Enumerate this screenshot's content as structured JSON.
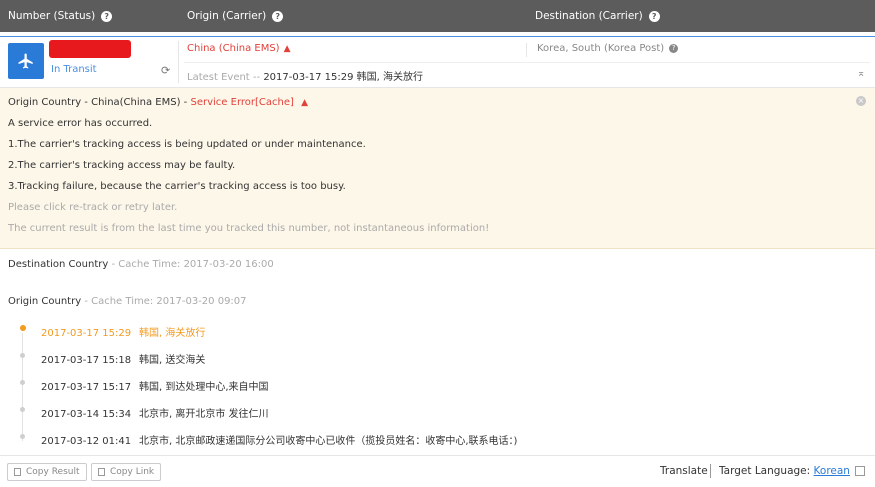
{
  "header": {
    "col_number": "Number (Status)",
    "col_origin": "Origin (Carrier)",
    "col_destination": "Destination (Carrier)"
  },
  "tracking": {
    "status": "In Transit",
    "origin": "China (China EMS)",
    "destination": "Korea, South (Korea Post)",
    "latest_label": "Latest Event --",
    "latest_event": "2017-03-17 15:29 韩国, 海关放行"
  },
  "error_panel": {
    "title_prefix": "Origin Country - China(China EMS) -",
    "title_error": "Service Error[Cache]",
    "lines": [
      "A service error has occurred.",
      "1.The carrier's tracking access is being updated or under maintenance.",
      "2.The carrier's tracking access may be faulty.",
      "3.Tracking failure, because the carrier's tracking access is too busy."
    ],
    "hint_retry": "Please click re-track or retry later.",
    "hint_cache": "The current result is from the last time you tracked this number, not instantaneous information!"
  },
  "destination_section": {
    "label": "Destination Country",
    "cache": "- Cache Time: 2017-03-20 16:00"
  },
  "origin_section": {
    "label": "Origin Country",
    "cache": "- Cache Time: 2017-03-20 09:07"
  },
  "events": [
    {
      "time": "2017-03-17 15:29",
      "desc": "韩国, 海关放行"
    },
    {
      "time": "2017-03-17 15:18",
      "desc": "韩国, 送交海关"
    },
    {
      "time": "2017-03-17 15:17",
      "desc": "韩国, 到达处理中心,来自中国"
    },
    {
      "time": "2017-03-14 15:34",
      "desc": "北京市, 离开北京市 发往仁川"
    },
    {
      "time": "2017-03-12 01:41",
      "desc": "北京市, 北京邮政速递国际分公司收寄中心已收件（揽投员姓名：收寄中心,联系电话：)"
    }
  ],
  "footer": {
    "copy_result": "Copy Result",
    "copy_link": "Copy Link",
    "translate": "Translate",
    "target_language_label": "Target Language:",
    "target_language": "Korean"
  },
  "colors": {
    "accent_blue": "#2a7bd8",
    "error_red": "#e2403a",
    "active_orange": "#f39a1f",
    "header_bg": "#5c5c5c",
    "error_bg": "#fdf7e9"
  },
  "icons": {
    "status": "airplane-icon",
    "help": "question-circle-icon",
    "warning": "warning-triangle-icon",
    "refresh": "refresh-icon",
    "expand": "expand-icon",
    "close": "close-circle-icon",
    "copy": "copy-icon"
  }
}
